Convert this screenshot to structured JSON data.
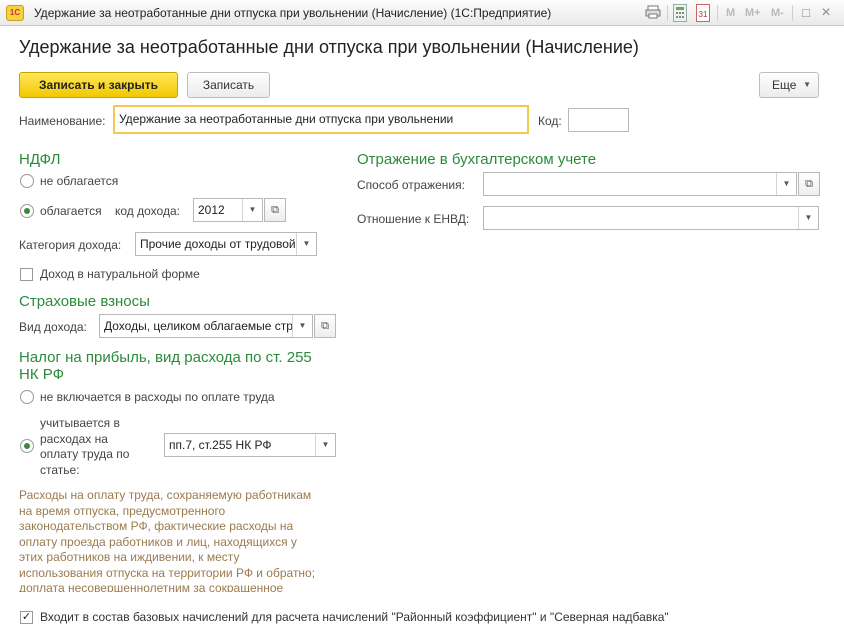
{
  "window": {
    "logo": "1C",
    "title": "Удержание за неотработанные дни отпуска при увольнении (Начисление)  (1С:Предприятие)",
    "toolbar": {
      "icons": [
        "print-icon",
        "calculator-icon",
        "calendar-icon"
      ],
      "calendar_day": "31",
      "memory_buttons": [
        "M",
        "M+",
        "M-"
      ],
      "window_buttons": [
        "□",
        "×"
      ]
    }
  },
  "form": {
    "title": "Удержание за неотработанные дни отпуска при увольнении (Начисление)",
    "buttons": {
      "save_close": "Записать и закрыть",
      "save": "Записать",
      "more": "Еще"
    },
    "name": {
      "label": "Наименование:",
      "value": "Удержание за неотработанные дни отпуска при увольнении"
    },
    "code": {
      "label": "Код:",
      "value": ""
    },
    "ndfl": {
      "heading": "НДФЛ",
      "option_not_taxed": "не облагается",
      "option_taxed": "облагается",
      "selected": "taxed",
      "income_code_label": "код дохода:",
      "income_code_value": "2012",
      "income_category_label": "Категория дохода:",
      "income_category_value": "Прочие доходы от трудовой деятельности",
      "natural_income_label": "Доход в натуральной форме",
      "natural_income_checked": false
    },
    "insurance": {
      "heading": "Страховые взносы",
      "income_type_label": "Вид дохода:",
      "income_type_value": "Доходы, целиком облагаемые страховыми взносами"
    },
    "profit_tax": {
      "heading_line1": "Налог на прибыль, вид расхода по ст. 255",
      "heading_line2": "НК РФ",
      "option_not_included": "не включается в расходы по оплате труда",
      "option_included_line1": "учитывается в",
      "option_included_line2": "расходах на",
      "option_included_line3": "оплату труда по",
      "option_included_line4": "статье:",
      "selected": "included",
      "article_value": "пп.7, ст.255 НК РФ",
      "note_lines": [
        "Расходы на оплату труда, сохраняемую работникам",
        "на время отпуска, предусмотренного",
        "законодательством РФ, фактические расходы на",
        "оплату проезда работников и лиц, находящихся у",
        "этих работников на иждивении, к месту",
        "использования отпуска на территории РФ и обратно;",
        "доплата несовершеннолетним за сокращенное"
      ]
    },
    "accounting": {
      "heading": "Отражение в бухгалтерском учете",
      "method_label": "Способ отражения:",
      "method_value": "",
      "envd_label": "Отношение к ЕНВД:",
      "envd_value": ""
    },
    "base_accruals": {
      "label": "Входит в состав базовых начислений для расчета начислений \"Районный коэффициент\" и \"Северная надбавка\"",
      "checked": true
    }
  }
}
